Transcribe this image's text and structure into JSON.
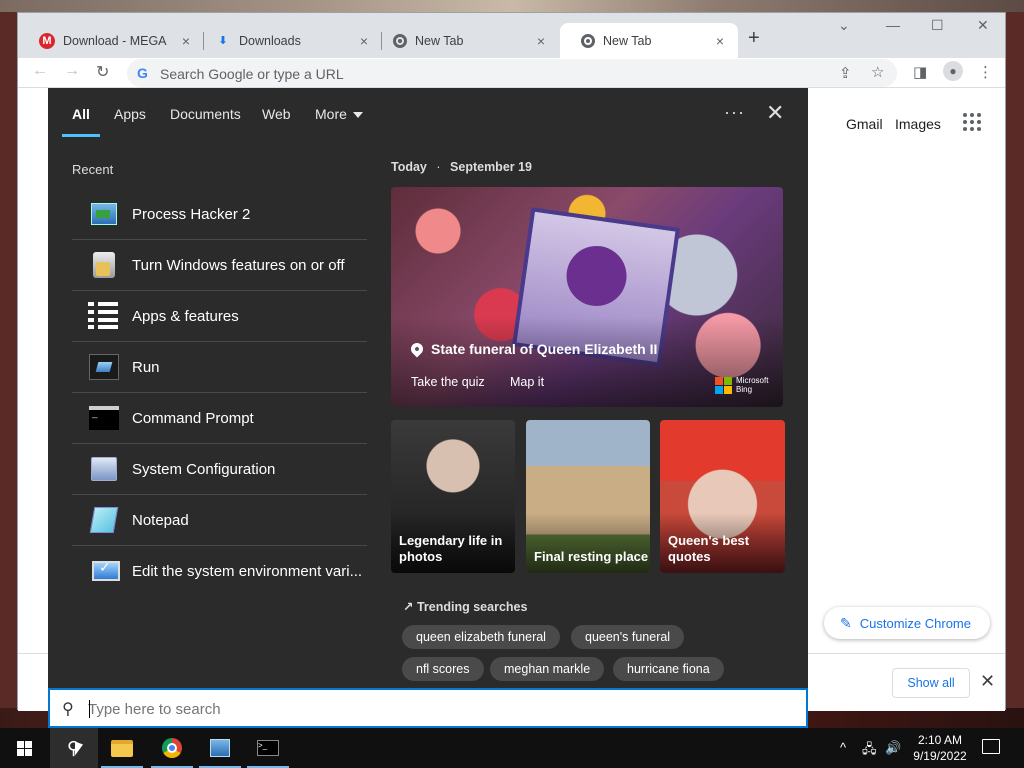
{
  "browser": {
    "tabs": [
      {
        "title": "Download - MEGA",
        "icon": "mega-icon",
        "icon_glyph": "M"
      },
      {
        "title": "Downloads",
        "icon": "download-icon",
        "icon_glyph": "⬇"
      },
      {
        "title": "New Tab",
        "icon": "chrome-icon",
        "icon_glyph": ""
      },
      {
        "title": "New Tab",
        "icon": "chrome-icon",
        "icon_glyph": "",
        "active": true
      }
    ],
    "tab_close_glyph": "×",
    "new_tab_glyph": "+",
    "omnibox": {
      "placeholder": "Search Google or type a URL",
      "g_glyph": "G"
    },
    "ntp": {
      "gmail": "Gmail",
      "images": "Images",
      "customize": "Customize Chrome"
    },
    "download_bar": {
      "show_all": "Show all",
      "close_glyph": "✕"
    }
  },
  "search_flyout": {
    "tabs": [
      "All",
      "Apps",
      "Documents",
      "Web",
      "More"
    ],
    "active_tab": "All",
    "options_glyph": "···",
    "close_glyph": "✕",
    "recent_heading": "Recent",
    "recent": [
      {
        "label": "Process Hacker 2",
        "icon": "process-hacker-icon"
      },
      {
        "label": "Turn Windows features on or off",
        "icon": "windows-features-icon"
      },
      {
        "label": "Apps & features",
        "icon": "apps-features-icon"
      },
      {
        "label": "Run",
        "icon": "run-icon"
      },
      {
        "label": "Command Prompt",
        "icon": "command-prompt-icon"
      },
      {
        "label": "System Configuration",
        "icon": "system-configuration-icon"
      },
      {
        "label": "Notepad",
        "icon": "notepad-icon"
      },
      {
        "label": "Edit the system environment vari...",
        "icon": "environment-variables-icon"
      }
    ],
    "today": {
      "label": "Today",
      "sep": "·",
      "date": "September 19"
    },
    "hero": {
      "title": "State funeral of Queen Elizabeth II",
      "links": [
        "Take the quiz",
        "Map it"
      ],
      "brand_line1": "Microsoft",
      "brand_line2": "Bing"
    },
    "cards": [
      {
        "label": "Legendary life in photos"
      },
      {
        "label": "Final resting place"
      },
      {
        "label": "Queen's best quotes"
      }
    ],
    "trending_heading": "Trending searches",
    "trending_glyph": "↗",
    "trending": [
      "queen elizabeth funeral",
      "queen's funeral",
      "nfl scores",
      "meghan markle",
      "hurricane fiona"
    ],
    "search_box": {
      "placeholder": "Type here to search"
    }
  },
  "taskbar": {
    "clock_time": "2:10 AM",
    "clock_date": "9/19/2022",
    "tray_glyphs": {
      "chevron": "^",
      "network": "🖧",
      "volume": "🔊"
    }
  },
  "colors": {
    "accent": "#0078d4",
    "flyout_bg": "#2b2b2b",
    "tab_underline": "#4cc2ff",
    "chrome_blue": "#1a73e8",
    "mega_red": "#d9272e"
  }
}
